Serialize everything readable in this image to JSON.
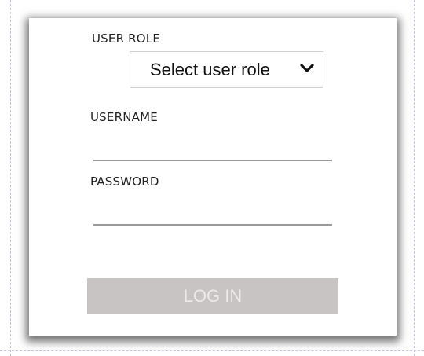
{
  "form": {
    "user_role": {
      "label": "USER ROLE",
      "selected_value": "Select user role",
      "icon": "chevron-down-icon"
    },
    "username": {
      "label": "USERNAME",
      "value": "",
      "placeholder": ""
    },
    "password": {
      "label": "PASSWORD",
      "value": "",
      "placeholder": ""
    },
    "login_button_label": "LOG IN"
  },
  "colors": {
    "button_bg": "#c8c4c3",
    "button_text": "#ebe9e9",
    "input_underline": "#9a9a9a",
    "guide_lines": "#c9c4e6"
  }
}
